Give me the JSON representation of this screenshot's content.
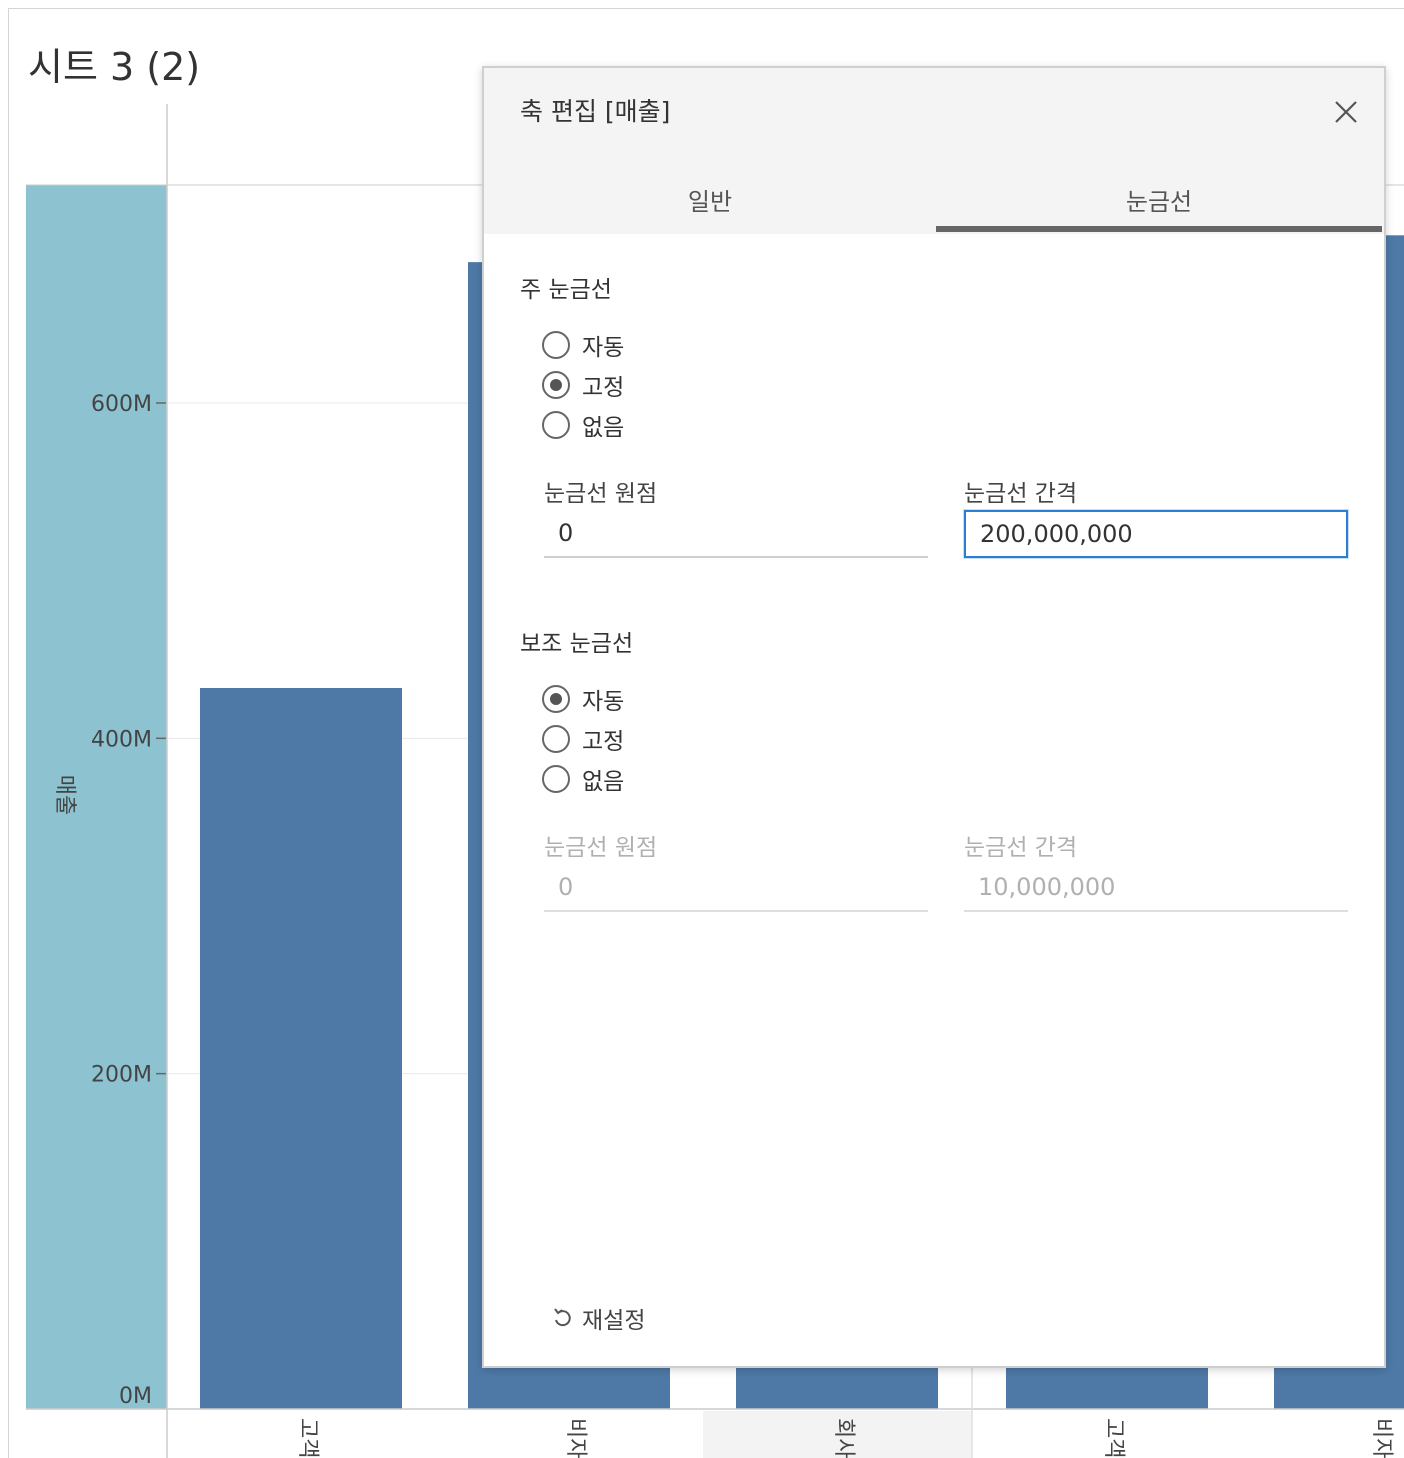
{
  "worksheet": {
    "title": "시트 3 (2)"
  },
  "chart_data": {
    "type": "bar",
    "ylabel": "매출",
    "yticks": [
      "0M",
      "200M",
      "400M",
      "600M"
    ],
    "ylim": [
      0,
      730
    ],
    "categories": [
      "고객",
      "비자",
      "회사",
      "고객",
      "비자"
    ],
    "values": [
      430,
      684,
      684,
      684,
      700
    ],
    "colors": {
      "bar": "#4e79a7",
      "highlight_column": "#8dc3d1",
      "gridline": "#e8e8e8",
      "axis": "#cccccc"
    }
  },
  "dialog": {
    "title": "축 편집 [매출]",
    "close_icon": "close-icon",
    "tabs": [
      {
        "label": "일반",
        "selected": false
      },
      {
        "label": "눈금선",
        "selected": true
      }
    ],
    "major": {
      "section_title": "주 눈금선",
      "options": [
        {
          "label": "자동",
          "checked": false
        },
        {
          "label": "고정",
          "checked": true
        },
        {
          "label": "없음",
          "checked": false
        }
      ],
      "origin_label": "눈금선 원점",
      "origin_value": "0",
      "interval_label": "눈금선 간격",
      "interval_value": "200,000,000"
    },
    "minor": {
      "section_title": "보조 눈금선",
      "options": [
        {
          "label": "자동",
          "checked": true
        },
        {
          "label": "고정",
          "checked": false
        },
        {
          "label": "없음",
          "checked": false
        }
      ],
      "origin_label": "눈금선 원점",
      "origin_value": "0",
      "interval_label": "눈금선 간격",
      "interval_value": "10,000,000"
    },
    "reset_label": "재설정",
    "reset_icon": "undo-icon"
  }
}
